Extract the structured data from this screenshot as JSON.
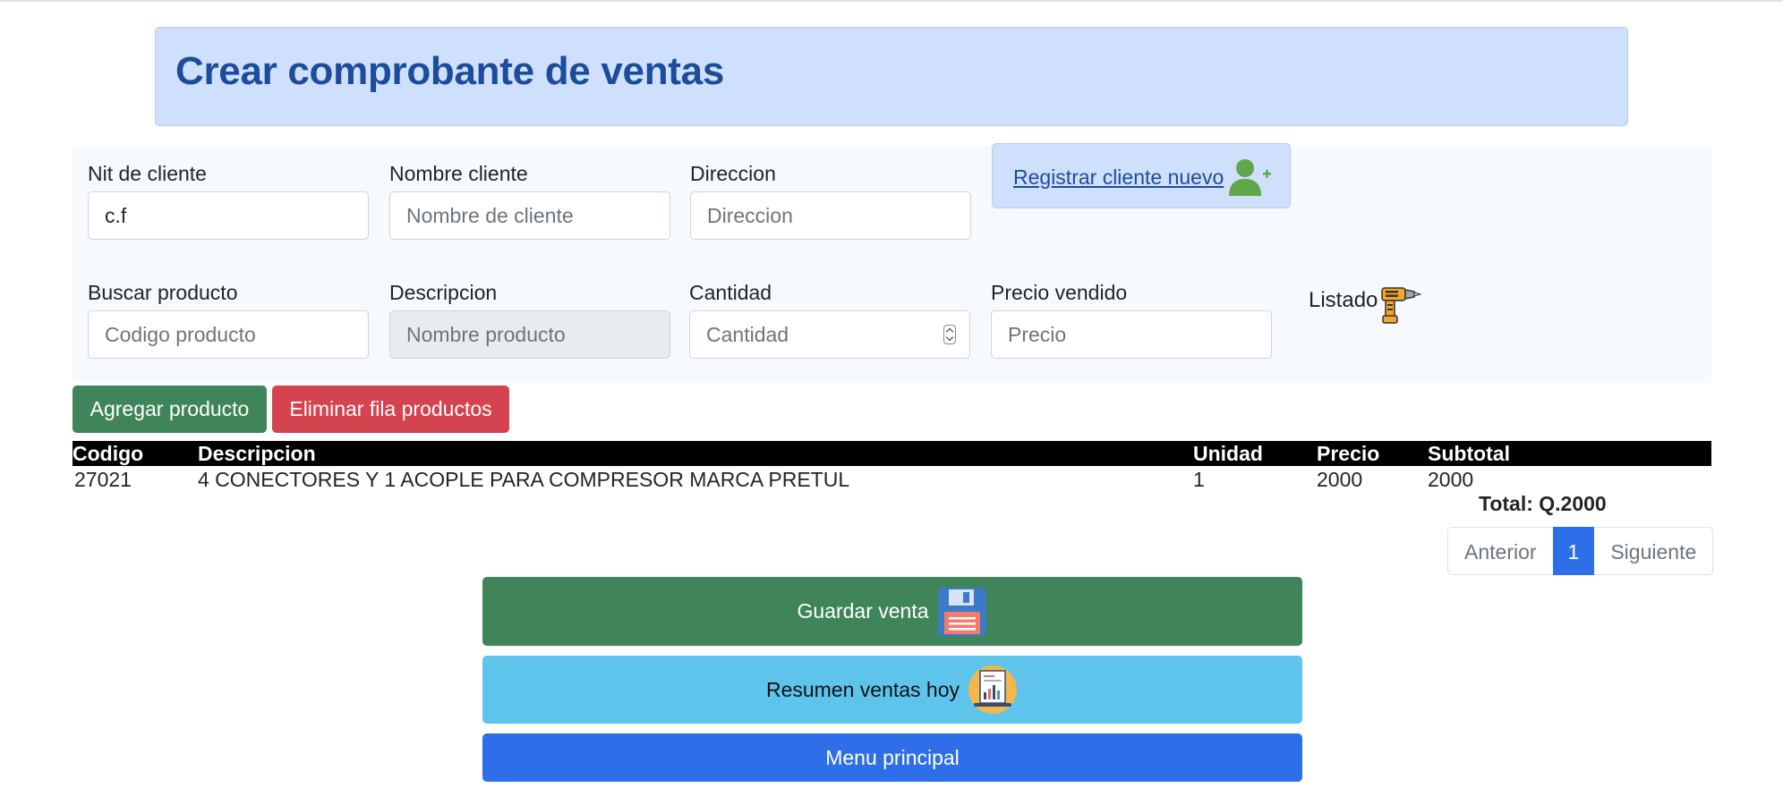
{
  "header": {
    "title": "Crear comprobante de ventas"
  },
  "client": {
    "nit_label": "Nit de cliente",
    "nit_value": "c.f",
    "name_label": "Nombre cliente",
    "name_placeholder": "Nombre de cliente",
    "address_label": "Direccion",
    "address_placeholder": "Direccion",
    "register_link": "Registrar cliente nuevo",
    "register_icon": "add-user-icon"
  },
  "product": {
    "search_label": "Buscar producto",
    "search_placeholder": "Codigo producto",
    "desc_label": "Descripcion",
    "desc_placeholder": "Nombre producto",
    "qty_label": "Cantidad",
    "qty_placeholder": "Cantidad",
    "price_label": "Precio vendido",
    "price_placeholder": "Precio",
    "list_label": "Listado",
    "list_icon": "drill-icon"
  },
  "actions": {
    "add_label": "Agregar producto",
    "remove_label": "Eliminar fila productos",
    "save_label": "Guardar venta",
    "summary_label": "Resumen ventas hoy",
    "menu_label": "Menu principal"
  },
  "table": {
    "headers": [
      "Codigo",
      "Descripcion",
      "Unidad",
      "Precio",
      "Subtotal"
    ],
    "rows": [
      [
        "27021",
        "4 CONECTORES Y 1 ACOPLE PARA COMPRESOR MARCA PRETUL",
        "1",
        "2000",
        "2000"
      ]
    ],
    "total": "Total: Q.2000"
  },
  "pagination": {
    "prev": "Anterior",
    "current": "1",
    "next": "Siguiente"
  },
  "colors": {
    "header_bg": "#cfe0fc",
    "title": "#1d4c9c",
    "success": "#3f8559",
    "danger": "#d4444f",
    "info": "#5ec4ec",
    "primary": "#2f6ee9"
  }
}
